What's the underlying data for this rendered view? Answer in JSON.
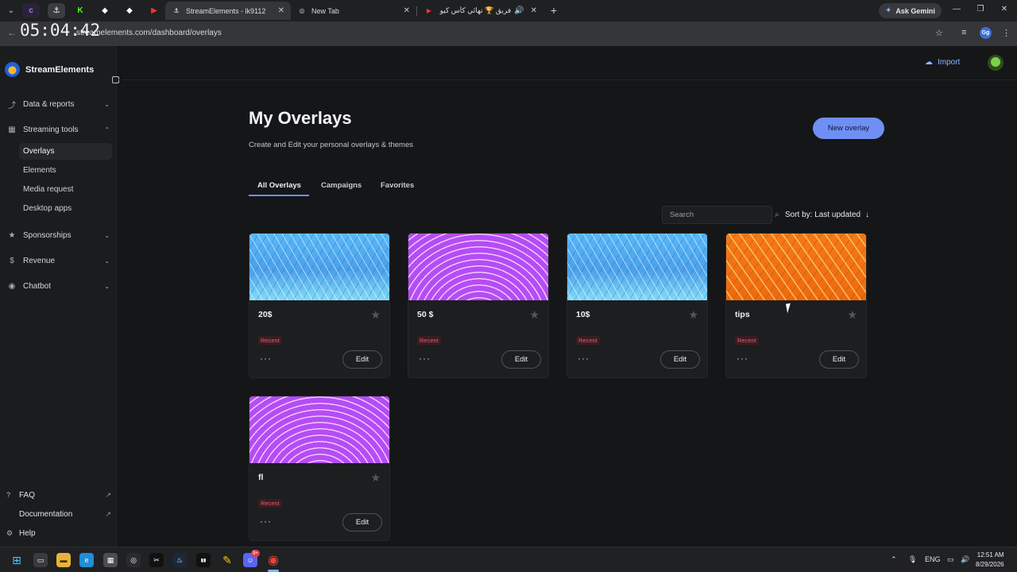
{
  "browser": {
    "clock_overlay": "05:04:42",
    "tabs": [
      {
        "title": "StreamElements - lk9112",
        "active": true
      },
      {
        "title": "New Tab",
        "active": false
      },
      {
        "title": "ﻓﺮﻳﻖ 🏆 نهائي كأس كيو بي",
        "active": false
      }
    ],
    "url": "streamelements.com/dashboard/overlays",
    "ask_gemini": "Ask Gemini",
    "profile_initials": "Gg"
  },
  "sidebar": {
    "brand": "StreamElements",
    "sections": [
      {
        "label": "Data & reports",
        "icon": "chart-icon"
      },
      {
        "label": "Streaming tools",
        "icon": "tools-icon"
      }
    ],
    "sub_items": [
      "Overlays",
      "Elements",
      "Media request",
      "Desktop apps"
    ],
    "lower_sections": [
      {
        "label": "Sponsorships",
        "icon": "star-icon"
      },
      {
        "label": "Revenue",
        "icon": "dollar-icon"
      },
      {
        "label": "Chatbot",
        "icon": "bot-icon"
      }
    ],
    "footer": [
      "FAQ",
      "Documentation",
      "Help"
    ]
  },
  "header": {
    "import_label": "Import"
  },
  "main": {
    "title": "My Overlays",
    "subtitle": "Create and Edit your personal overlays & themes",
    "new_button": "New overlay",
    "tabs": [
      "All Overlays",
      "Campaigns",
      "Favorites"
    ],
    "search_placeholder": "Search",
    "sort_label": "Sort by: Last updated",
    "cards": [
      {
        "name": "20$",
        "badge": "Recent",
        "theme": "blue",
        "edit": "Edit",
        "more": "···"
      },
      {
        "name": "50 $",
        "badge": "Recent",
        "theme": "purple",
        "edit": "Edit",
        "more": "···"
      },
      {
        "name": "10$",
        "badge": "Recent",
        "theme": "blue",
        "edit": "Edit",
        "more": "···"
      },
      {
        "name": "tips",
        "badge": "Recent",
        "theme": "orange",
        "edit": "Edit",
        "more": "···"
      },
      {
        "name": "fl",
        "badge": "Recent",
        "theme": "purple",
        "edit": "Edit",
        "more": "···"
      }
    ]
  },
  "taskbar": {
    "lang": "ENG",
    "time": "12:51 AM",
    "date": "8/29/2026",
    "notification_count": "9+"
  },
  "colors": {
    "accent": "#6f8ff5",
    "badge_text": "#e85a6c",
    "background": "#151617"
  }
}
